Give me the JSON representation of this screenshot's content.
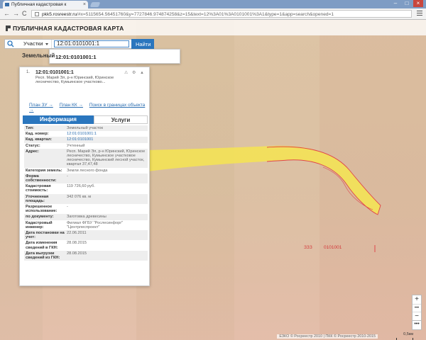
{
  "browser": {
    "tab_title": "Публичная кадастровая к",
    "tab_close": "×",
    "url_host": "pkk5.rosreestr.ru",
    "url_rest": "/#x=5115654.56451760&y=7727846.974874258&z=15&text=12%3A01%3A0101001%3A1&type=1&app=search&opened=1",
    "nav": {
      "back": "←",
      "forward": "→",
      "reload": "C"
    }
  },
  "site": {
    "title": "ПУБЛИЧНАЯ КАДАСТРОВАЯ КАРТА"
  },
  "search": {
    "type": "Участки",
    "query": "12:01:0101001:1",
    "button": "Найти",
    "suggestion": "12:01:0101001:1"
  },
  "section_title": "Земельный",
  "card": {
    "number": "1.",
    "cadastral_number": "12:01:0101001:1",
    "address": "Респ. Марий Эл, р-н Юринский, Юринское лесничество, Кумьинское участково...",
    "tools": "⚠ ⚙ ▲",
    "links": [
      "План ЗУ →",
      "План КК →",
      "Поиск в границах объекта →"
    ],
    "tabs": {
      "info": "Информация",
      "services": "Услуги"
    },
    "details": [
      {
        "k": "Тип:",
        "v": "Земельный участок",
        "link": false
      },
      {
        "k": "Кад. номер:",
        "v": "12:01:0101001:1",
        "link": true
      },
      {
        "k": "Кад. квартал:",
        "v": "12:01:0101001",
        "link": true
      },
      {
        "k": "Статус:",
        "v": "Учтенный",
        "link": false
      },
      {
        "k": "Адрес:",
        "v": "Респ. Марий Эл, р-н Юринский, Юринское лесничество, Кумьинское участковое лесничество, Кумьинский лесной участок, квартал 37,47,48",
        "link": false
      },
      {
        "k": "Категория земель:",
        "v": "Земли лесного фонда",
        "link": false
      },
      {
        "k": "Форма собственности:",
        "v": "-",
        "link": false
      },
      {
        "k": "Кадастровая стоимость:",
        "v": "119 726,60 руб.",
        "link": false
      },
      {
        "k": "Уточненная площадь:",
        "v": "342 076 кв. м",
        "link": false
      },
      {
        "k": "Разрешенное использование:",
        "v": "-",
        "link": false
      },
      {
        "k": "по документу:",
        "v": "Заготовка древесины",
        "link": false
      },
      {
        "k": "Кадастровый инженер:",
        "v": "Филиал ФГБУ \"Рослесинфорг\" \"Центрлеспроект\"",
        "link": false
      },
      {
        "k": "Дата постановки на учет:",
        "v": "22.06.2011",
        "link": false
      },
      {
        "k": "Дата изменения сведений в ГКН:",
        "v": "28.08.2015",
        "link": false
      },
      {
        "k": "Дата выгрузки сведений из ГКН:",
        "v": "28.08.2015",
        "link": false
      }
    ]
  },
  "map": {
    "label_left": "ЗЗЗ",
    "label_right": "0101001",
    "zoom_in": "+",
    "zoom_mid": "•••",
    "zoom_out": "−",
    "more": "•••",
    "copyright": "ЕЗКО © Росреестр 2010 | ПКК © Росреестр 2010-2015",
    "scale": "0,5км",
    "colors": {
      "parcel_fill": "#f2e05a",
      "parcel_stroke": "#e0454a",
      "accent": "#2a76be"
    }
  }
}
